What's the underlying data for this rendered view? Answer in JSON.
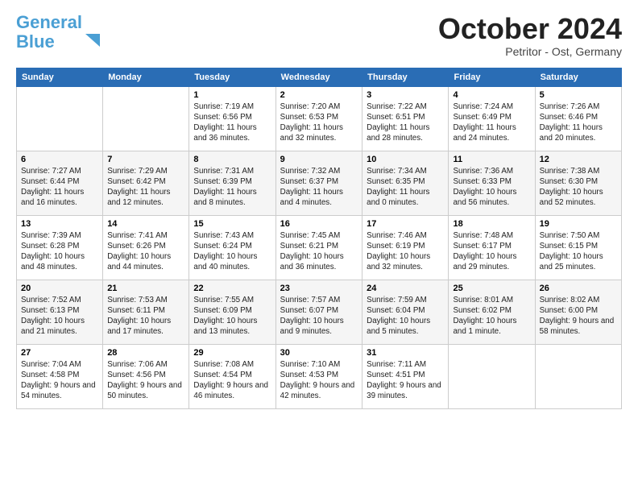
{
  "logo": {
    "line1": "General",
    "line2": "Blue"
  },
  "header": {
    "month": "October 2024",
    "location": "Petritor - Ost, Germany"
  },
  "days_of_week": [
    "Sunday",
    "Monday",
    "Tuesday",
    "Wednesday",
    "Thursday",
    "Friday",
    "Saturday"
  ],
  "weeks": [
    [
      {
        "day": "",
        "info": ""
      },
      {
        "day": "",
        "info": ""
      },
      {
        "day": "1",
        "info": "Sunrise: 7:19 AM\nSunset: 6:56 PM\nDaylight: 11 hours\nand 36 minutes."
      },
      {
        "day": "2",
        "info": "Sunrise: 7:20 AM\nSunset: 6:53 PM\nDaylight: 11 hours\nand 32 minutes."
      },
      {
        "day": "3",
        "info": "Sunrise: 7:22 AM\nSunset: 6:51 PM\nDaylight: 11 hours\nand 28 minutes."
      },
      {
        "day": "4",
        "info": "Sunrise: 7:24 AM\nSunset: 6:49 PM\nDaylight: 11 hours\nand 24 minutes."
      },
      {
        "day": "5",
        "info": "Sunrise: 7:26 AM\nSunset: 6:46 PM\nDaylight: 11 hours\nand 20 minutes."
      }
    ],
    [
      {
        "day": "6",
        "info": "Sunrise: 7:27 AM\nSunset: 6:44 PM\nDaylight: 11 hours\nand 16 minutes."
      },
      {
        "day": "7",
        "info": "Sunrise: 7:29 AM\nSunset: 6:42 PM\nDaylight: 11 hours\nand 12 minutes."
      },
      {
        "day": "8",
        "info": "Sunrise: 7:31 AM\nSunset: 6:39 PM\nDaylight: 11 hours\nand 8 minutes."
      },
      {
        "day": "9",
        "info": "Sunrise: 7:32 AM\nSunset: 6:37 PM\nDaylight: 11 hours\nand 4 minutes."
      },
      {
        "day": "10",
        "info": "Sunrise: 7:34 AM\nSunset: 6:35 PM\nDaylight: 11 hours\nand 0 minutes."
      },
      {
        "day": "11",
        "info": "Sunrise: 7:36 AM\nSunset: 6:33 PM\nDaylight: 10 hours\nand 56 minutes."
      },
      {
        "day": "12",
        "info": "Sunrise: 7:38 AM\nSunset: 6:30 PM\nDaylight: 10 hours\nand 52 minutes."
      }
    ],
    [
      {
        "day": "13",
        "info": "Sunrise: 7:39 AM\nSunset: 6:28 PM\nDaylight: 10 hours\nand 48 minutes."
      },
      {
        "day": "14",
        "info": "Sunrise: 7:41 AM\nSunset: 6:26 PM\nDaylight: 10 hours\nand 44 minutes."
      },
      {
        "day": "15",
        "info": "Sunrise: 7:43 AM\nSunset: 6:24 PM\nDaylight: 10 hours\nand 40 minutes."
      },
      {
        "day": "16",
        "info": "Sunrise: 7:45 AM\nSunset: 6:21 PM\nDaylight: 10 hours\nand 36 minutes."
      },
      {
        "day": "17",
        "info": "Sunrise: 7:46 AM\nSunset: 6:19 PM\nDaylight: 10 hours\nand 32 minutes."
      },
      {
        "day": "18",
        "info": "Sunrise: 7:48 AM\nSunset: 6:17 PM\nDaylight: 10 hours\nand 29 minutes."
      },
      {
        "day": "19",
        "info": "Sunrise: 7:50 AM\nSunset: 6:15 PM\nDaylight: 10 hours\nand 25 minutes."
      }
    ],
    [
      {
        "day": "20",
        "info": "Sunrise: 7:52 AM\nSunset: 6:13 PM\nDaylight: 10 hours\nand 21 minutes."
      },
      {
        "day": "21",
        "info": "Sunrise: 7:53 AM\nSunset: 6:11 PM\nDaylight: 10 hours\nand 17 minutes."
      },
      {
        "day": "22",
        "info": "Sunrise: 7:55 AM\nSunset: 6:09 PM\nDaylight: 10 hours\nand 13 minutes."
      },
      {
        "day": "23",
        "info": "Sunrise: 7:57 AM\nSunset: 6:07 PM\nDaylight: 10 hours\nand 9 minutes."
      },
      {
        "day": "24",
        "info": "Sunrise: 7:59 AM\nSunset: 6:04 PM\nDaylight: 10 hours\nand 5 minutes."
      },
      {
        "day": "25",
        "info": "Sunrise: 8:01 AM\nSunset: 6:02 PM\nDaylight: 10 hours\nand 1 minute."
      },
      {
        "day": "26",
        "info": "Sunrise: 8:02 AM\nSunset: 6:00 PM\nDaylight: 9 hours\nand 58 minutes."
      }
    ],
    [
      {
        "day": "27",
        "info": "Sunrise: 7:04 AM\nSunset: 4:58 PM\nDaylight: 9 hours\nand 54 minutes."
      },
      {
        "day": "28",
        "info": "Sunrise: 7:06 AM\nSunset: 4:56 PM\nDaylight: 9 hours\nand 50 minutes."
      },
      {
        "day": "29",
        "info": "Sunrise: 7:08 AM\nSunset: 4:54 PM\nDaylight: 9 hours\nand 46 minutes."
      },
      {
        "day": "30",
        "info": "Sunrise: 7:10 AM\nSunset: 4:53 PM\nDaylight: 9 hours\nand 42 minutes."
      },
      {
        "day": "31",
        "info": "Sunrise: 7:11 AM\nSunset: 4:51 PM\nDaylight: 9 hours\nand 39 minutes."
      },
      {
        "day": "",
        "info": ""
      },
      {
        "day": "",
        "info": ""
      }
    ]
  ]
}
